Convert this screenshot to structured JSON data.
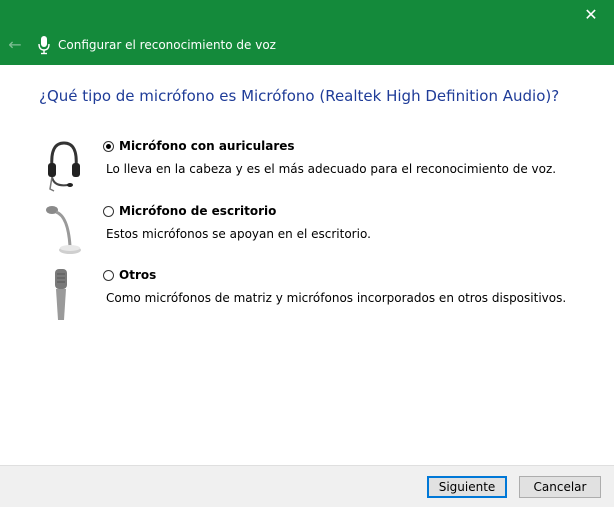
{
  "window": {
    "title": "Configurar el reconocimiento de voz",
    "close_glyph": "✕",
    "back_glyph": "←",
    "title_bar_color": "#148a3b"
  },
  "page": {
    "question": "¿Qué tipo de micrófono es Micrófono (Realtek High Definition Audio)?"
  },
  "options": [
    {
      "label": "Micrófono con auriculares",
      "description": "Lo lleva en la cabeza y es el más adecuado para el reconocimiento de voz.",
      "selected": true,
      "icon": "headset-icon"
    },
    {
      "label": "Micrófono de escritorio",
      "description": "Estos micrófonos se apoyan en el escritorio.",
      "selected": false,
      "icon": "desktop-microphone-icon"
    },
    {
      "label": "Otros",
      "description": "Como micrófonos de matriz y micrófonos incorporados en otros dispositivos.",
      "selected": false,
      "icon": "handheld-microphone-icon"
    }
  ],
  "buttons": {
    "next": "Siguiente",
    "cancel": "Cancelar"
  }
}
